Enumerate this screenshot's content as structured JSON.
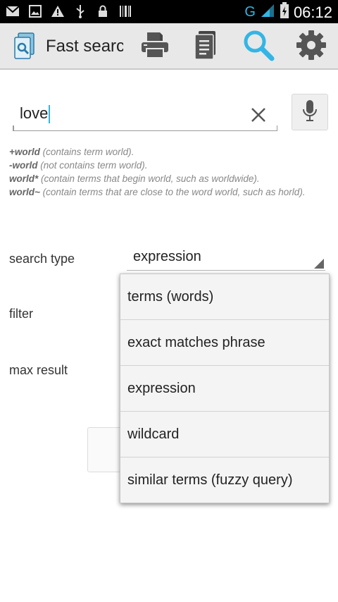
{
  "status_bar": {
    "network": "G",
    "time": "06:12",
    "icons": [
      "gmail-icon",
      "image-icon",
      "warning-icon",
      "usb-icon",
      "lock-icon",
      "barcode-icon"
    ]
  },
  "action_bar": {
    "app_title": "Fast searc",
    "buttons": [
      "printer-icon",
      "document-icon",
      "search-icon",
      "settings-gear-icon"
    ],
    "accent_color": "#33b5e5"
  },
  "search": {
    "query": "love"
  },
  "help": {
    "lines": [
      {
        "term": "+world",
        "desc": " (contains term world)."
      },
      {
        "term": "-world",
        "desc": " (not contains term world)."
      },
      {
        "term": "world*",
        "desc": " (contain terms that begin world, such as worldwide)."
      },
      {
        "term": "world~",
        "desc": " (contain terms that are close to the word world, such as horld)."
      }
    ]
  },
  "form": {
    "search_type_label": "search type",
    "search_type_value": "expression",
    "filter_label": "filter",
    "max_result_label": "max result"
  },
  "dropdown": {
    "options": [
      "terms (words)",
      "exact matches phrase",
      "expression",
      "wildcard",
      "similar terms (fuzzy query)"
    ]
  }
}
